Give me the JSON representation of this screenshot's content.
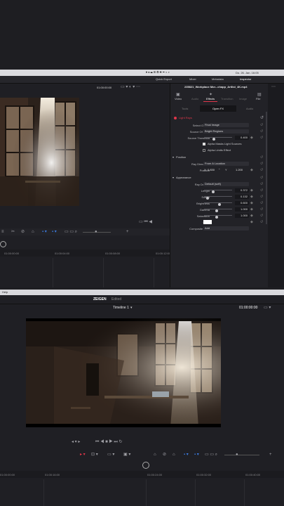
{
  "top": {
    "menubar": {
      "date_time": "Do. 26. Jan. 16:05"
    },
    "toolbar": {
      "quick_export": "Quick Export",
      "mixer": "Mixer",
      "metadata": "Metadata",
      "inspector": "Inspector",
      "timecode": "01:00:00:00"
    },
    "inspector": {
      "clip_name": "235821_Workplace Mor...chapp_Artlist_4K.mp4",
      "tabs": [
        "Video",
        "Audio",
        "Effects",
        "Transition",
        "Image",
        "File"
      ],
      "active_tab": "Effects",
      "subtabs": {
        "left": "Tools",
        "center": "Open FX",
        "right": "Audio"
      },
      "effect_name": "Light Rays",
      "rows": {
        "select_output_label": "Select Output",
        "select_output_value": "Final Image",
        "source_of_rays_label": "Source Of Rays",
        "source_of_rays_value": "Bright Regions",
        "source_threshold_label": "Source Threshold",
        "source_threshold_value": "0.400",
        "alpha_masks_label": "Alpha Masks Light Sources",
        "alpha_limits_label": "Alpha Limits Effect",
        "position_section": "Position",
        "ray_directions_label": "Ray Directions",
        "ray_directions_value": "From A Location",
        "position_label": "Position",
        "position_x_label": "X",
        "position_x_value": "0.830",
        "position_y_label": "Y",
        "position_y_value": "1.200",
        "appearance_section": "Appearance",
        "ray_dropoff_label": "Ray Dropoff",
        "ray_dropoff_value": "Default (soft)",
        "length_label": "Length",
        "length_value": "0.372",
        "soften_label": "Soften",
        "soften_value": "0.132",
        "brightness_label": "Brightness",
        "brightness_value": "0.600",
        "gamma_label": "Gamma",
        "gamma_value": "1.000",
        "saturation_label": "Saturation",
        "saturation_value": "1.000",
        "color_label": "Color",
        "composite_label": "Composite Type",
        "composite_value": "Add"
      },
      "levels": {
        "source_threshold": 0.4,
        "length": 0.372,
        "soften": 0.132,
        "brightness": 0.6,
        "gamma": 0.5,
        "saturation": 0.5
      }
    },
    "timeline": {
      "audio_label": "DIM",
      "ruler": [
        "01:00:00:00",
        "01:00:04:00",
        "01:00:08:00",
        "01:00:12:00",
        "01:00:16:00"
      ]
    }
  },
  "help_menu": "Help",
  "bottom": {
    "project": "ZEIGEN",
    "status": "Edited",
    "timeline_name": "Timeline 1",
    "timecode": "01:00:00:00",
    "ruler": [
      "01:00:00:00",
      "01:00:16:00",
      "01:00:24:00",
      "01:00:32:00",
      "01:00:40:00"
    ]
  },
  "colors": {
    "accent_red": "#e0364a",
    "accent_blue": "#3c7be0",
    "accent_green": "#3dbd5a"
  }
}
